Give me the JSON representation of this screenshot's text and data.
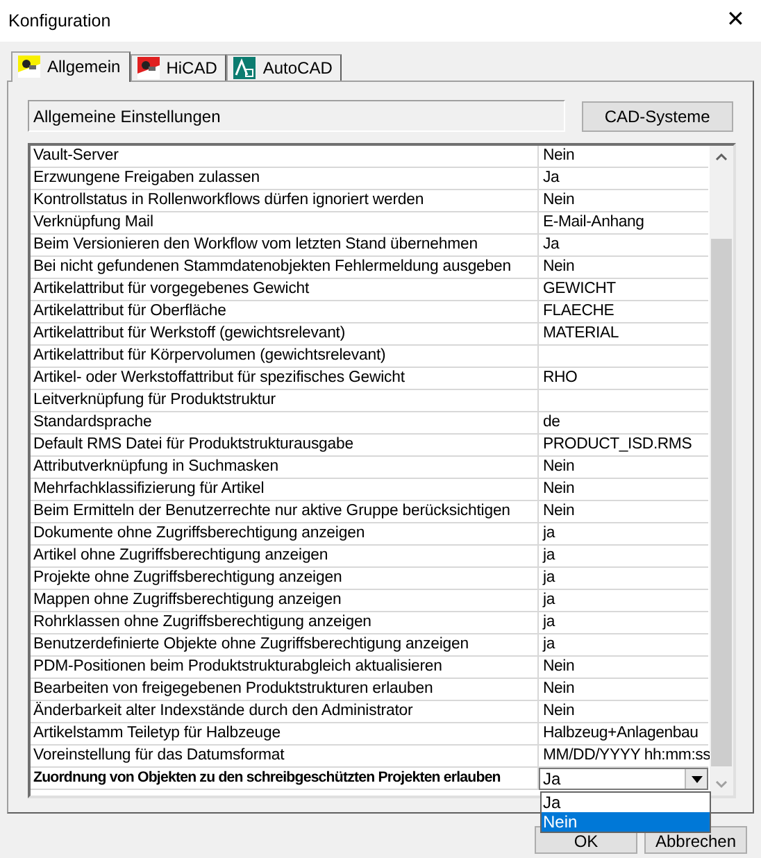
{
  "window": {
    "title": "Konfiguration",
    "close": "✕"
  },
  "tabs": [
    {
      "label": "Allgemein",
      "selected": true,
      "kind": "general"
    },
    {
      "label": "HiCAD",
      "selected": false,
      "kind": "hicad"
    },
    {
      "label": "AutoCAD",
      "selected": false,
      "kind": "autocad"
    }
  ],
  "section": {
    "label": "Allgemeine Einstellungen",
    "button": "CAD-Systeme"
  },
  "settings": [
    {
      "name": "Vault-Server",
      "value": "Nein",
      "selected": false
    },
    {
      "name": "Erzwungene Freigaben zulassen",
      "value": "Ja",
      "selected": false
    },
    {
      "name": "Kontrollstatus in Rollenworkflows dürfen ignoriert werden",
      "value": "Nein",
      "selected": false
    },
    {
      "name": "Verknüpfung Mail",
      "value": "E-Mail-Anhang",
      "selected": false
    },
    {
      "name": "Beim Versionieren den Workflow vom letzten Stand übernehmen",
      "value": "Ja",
      "selected": false
    },
    {
      "name": "Bei nicht gefundenen Stammdatenobjekten Fehlermeldung ausgeben",
      "value": "Nein",
      "selected": false
    },
    {
      "name": "Artikelattribut für vorgegebenes Gewicht",
      "value": "GEWICHT",
      "selected": false
    },
    {
      "name": "Artikelattribut für Oberfläche",
      "value": "FLAECHE",
      "selected": false
    },
    {
      "name": "Artikelattribut für Werkstoff (gewichtsrelevant)",
      "value": "MATERIAL",
      "selected": false
    },
    {
      "name": "Artikelattribut für Körpervolumen (gewichtsrelevant)",
      "selected": false
    },
    {
      "name": "Artikel- oder Werkstoffattribut für spezifisches Gewicht",
      "value": "RHO",
      "selected": false
    },
    {
      "name": "Leitverknüpfung für Produktstruktur",
      "selected": false
    },
    {
      "name": "Standardsprache",
      "value": "de",
      "selected": false
    },
    {
      "name": "Default RMS Datei für Produktstrukturausgabe",
      "value": "PRODUCT_ISD.RMS",
      "selected": false
    },
    {
      "name": "Attributverknüpfung in Suchmasken",
      "value": "Nein",
      "selected": false
    },
    {
      "name": "Mehrfachklassifizierung für Artikel",
      "value": "Nein",
      "selected": false
    },
    {
      "name": "Beim Ermitteln der Benutzerrechte nur aktive Gruppe berücksichtigen",
      "value": "Nein",
      "selected": false
    },
    {
      "name": "Dokumente ohne Zugriffsberechtigung anzeigen",
      "value": "ja",
      "selected": false
    },
    {
      "name": "Artikel ohne Zugriffsberechtigung anzeigen",
      "value": "ja",
      "selected": false
    },
    {
      "name": "Projekte ohne Zugriffsberechtigung anzeigen",
      "value": "ja",
      "selected": false
    },
    {
      "name": "Mappen ohne Zugriffsberechtigung anzeigen",
      "value": "ja",
      "selected": false
    },
    {
      "name": "Rohrklassen ohne Zugriffsberechtigung anzeigen",
      "value": "ja",
      "selected": false
    },
    {
      "name": "Benutzerdefinierte Objekte ohne Zugriffsberechtigung anzeigen",
      "value": "ja",
      "selected": false
    },
    {
      "name": "PDM-Positionen beim Produktstrukturabgleich aktualisieren",
      "value": "Nein",
      "selected": false
    },
    {
      "name": "Bearbeiten von freigegebenen Produktstrukturen erlauben",
      "value": "Nein",
      "selected": false
    },
    {
      "name": "Änderbarkeit alter Indexstände durch den Administrator",
      "value": "Nein",
      "selected": false
    },
    {
      "name": "Artikelstamm Teiletyp für Halbzeuge",
      "value": "Halbzeug+Anlagenbau",
      "selected": false
    },
    {
      "name": "Voreinstellung für das Datumsformat",
      "value": "MM/DD/YYYY hh:mm:ss",
      "selected": false
    },
    {
      "name": "Zuordnung von Objekten zu den schreibgeschützten Projekten erlauben",
      "value": "Ja",
      "selected": true,
      "kind": "combo"
    }
  ],
  "dropdown": {
    "options": [
      {
        "label": "Ja",
        "selected": false
      },
      {
        "label": "Nein",
        "selected": true
      }
    ]
  },
  "buttons": [
    "OK",
    "Abbrechen"
  ]
}
